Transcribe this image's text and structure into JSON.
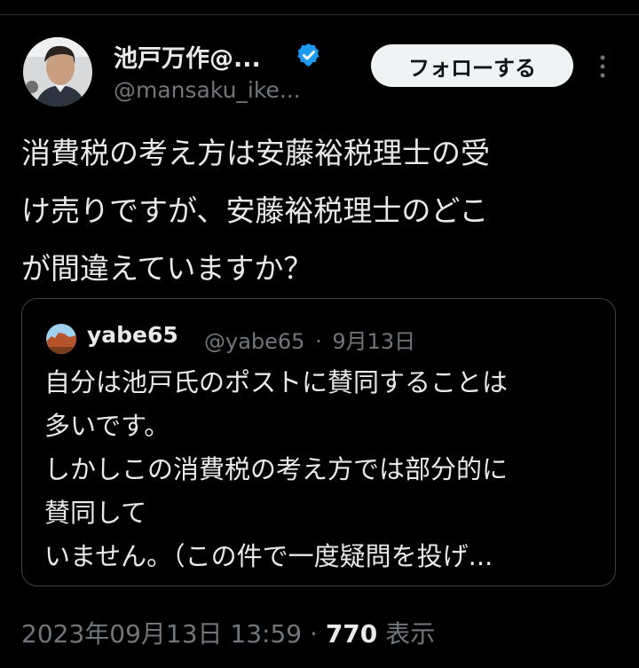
{
  "author": {
    "display_name": "池戸万作@...",
    "handle": "@mansaku_ike...",
    "verified": true
  },
  "follow_button": {
    "label": "フォローする"
  },
  "tweet": {
    "lines": [
      "消費税の考え方は安藤裕税理士の受",
      "け売りですが、安藤裕税理士のどこ",
      "が間違えていますか？"
    ]
  },
  "quoted_tweet": {
    "name": "yabe65",
    "handle": "@yabe65",
    "separator": "·",
    "date": "9月13日",
    "lines": [
      "自分は池戸氏のポストに賛同することは",
      "多いです。",
      "しかしこの消費税の考え方では部分的に",
      "賛同して",
      "いません。（この件で一度疑問を投げ..."
    ]
  },
  "footer": {
    "timestamp": "2023年09月13日 13:59",
    "separator": "·",
    "view_count": "770",
    "view_label": "表示"
  },
  "colors": {
    "background": "#000000",
    "text": "#e7e9ea",
    "muted": "#71767b",
    "verified": "#1d9bf0",
    "border": "#3e4144"
  }
}
